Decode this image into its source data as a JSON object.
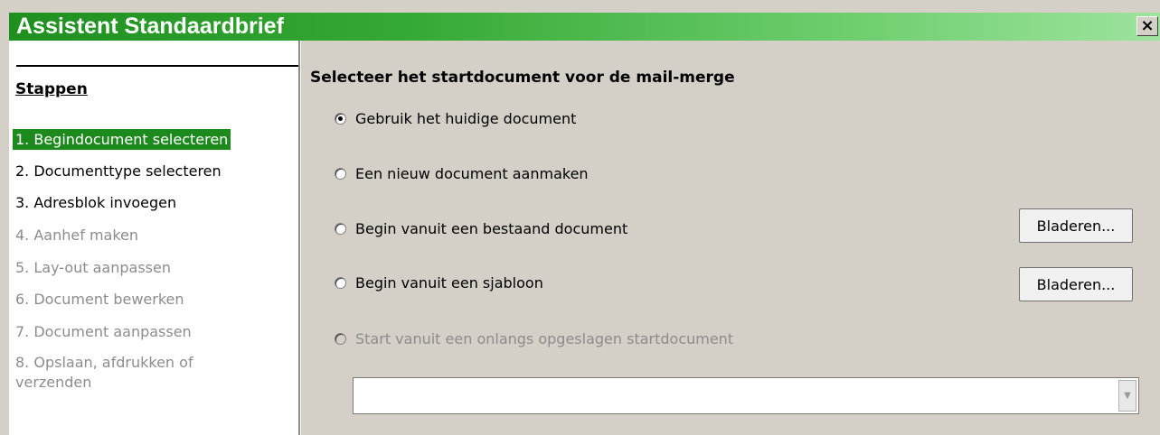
{
  "window": {
    "title": "Assistent Standaardbrief",
    "close_glyph": "×"
  },
  "sidebar": {
    "title": "Stappen",
    "steps": [
      {
        "label": "1. Begindocument selecteren",
        "state": "active"
      },
      {
        "label": "2. Documenttype selecteren",
        "state": "enabled"
      },
      {
        "label": "3. Adresblok invoegen",
        "state": "enabled"
      },
      {
        "label": "4. Aanhef maken",
        "state": "disabled"
      },
      {
        "label": "5. Lay-out aanpassen",
        "state": "disabled"
      },
      {
        "label": "6. Document bewerken",
        "state": "disabled"
      },
      {
        "label": "7. Document aanpassen",
        "state": "disabled"
      },
      {
        "label": "8. Opslaan, afdrukken of verzenden",
        "state": "disabled"
      }
    ]
  },
  "main": {
    "heading": "Selecteer het startdocument voor de mail-merge",
    "options": [
      {
        "label": "Gebruik het huidige document",
        "checked": true,
        "enabled": true
      },
      {
        "label": "Een nieuw document aanmaken",
        "checked": false,
        "enabled": true
      },
      {
        "label": "Begin vanuit een bestaand document",
        "checked": false,
        "enabled": true
      },
      {
        "label": "Begin vanuit een sjabloon",
        "checked": false,
        "enabled": true
      },
      {
        "label": "Start vanuit een onlangs opgeslagen startdocument",
        "checked": false,
        "enabled": false
      }
    ],
    "browse_existing_label": "Bladeren...",
    "browse_template_label": "Bladeren...",
    "recent_select": {
      "value": "",
      "arrow_glyph": "▼"
    }
  },
  "colors": {
    "title_gradient_start": "#1f8f1f",
    "title_gradient_end": "#9ee39e",
    "active_step_bg": "#1d8a1d",
    "dialog_bg": "#d4d0c8",
    "disabled_text": "#8c8c8c"
  }
}
